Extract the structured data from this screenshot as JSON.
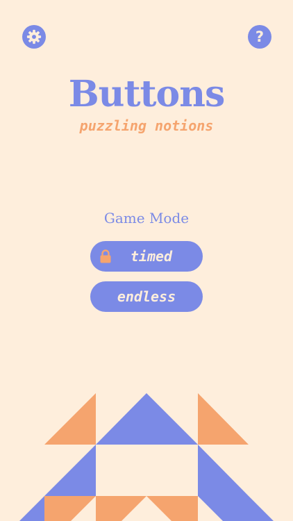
{
  "header": {
    "settings_icon": "gear-icon",
    "help_label": "?"
  },
  "title": "Buttons",
  "subtitle": "puzzling notions",
  "game_mode": {
    "label": "Game Mode",
    "buttons": [
      {
        "label": "timed",
        "locked": true,
        "icon": "lock-icon"
      },
      {
        "label": "endless",
        "locked": false
      }
    ]
  },
  "colors": {
    "background": "#FEEEDC",
    "primary": "#7B8AE6",
    "accent": "#F5A46E"
  }
}
